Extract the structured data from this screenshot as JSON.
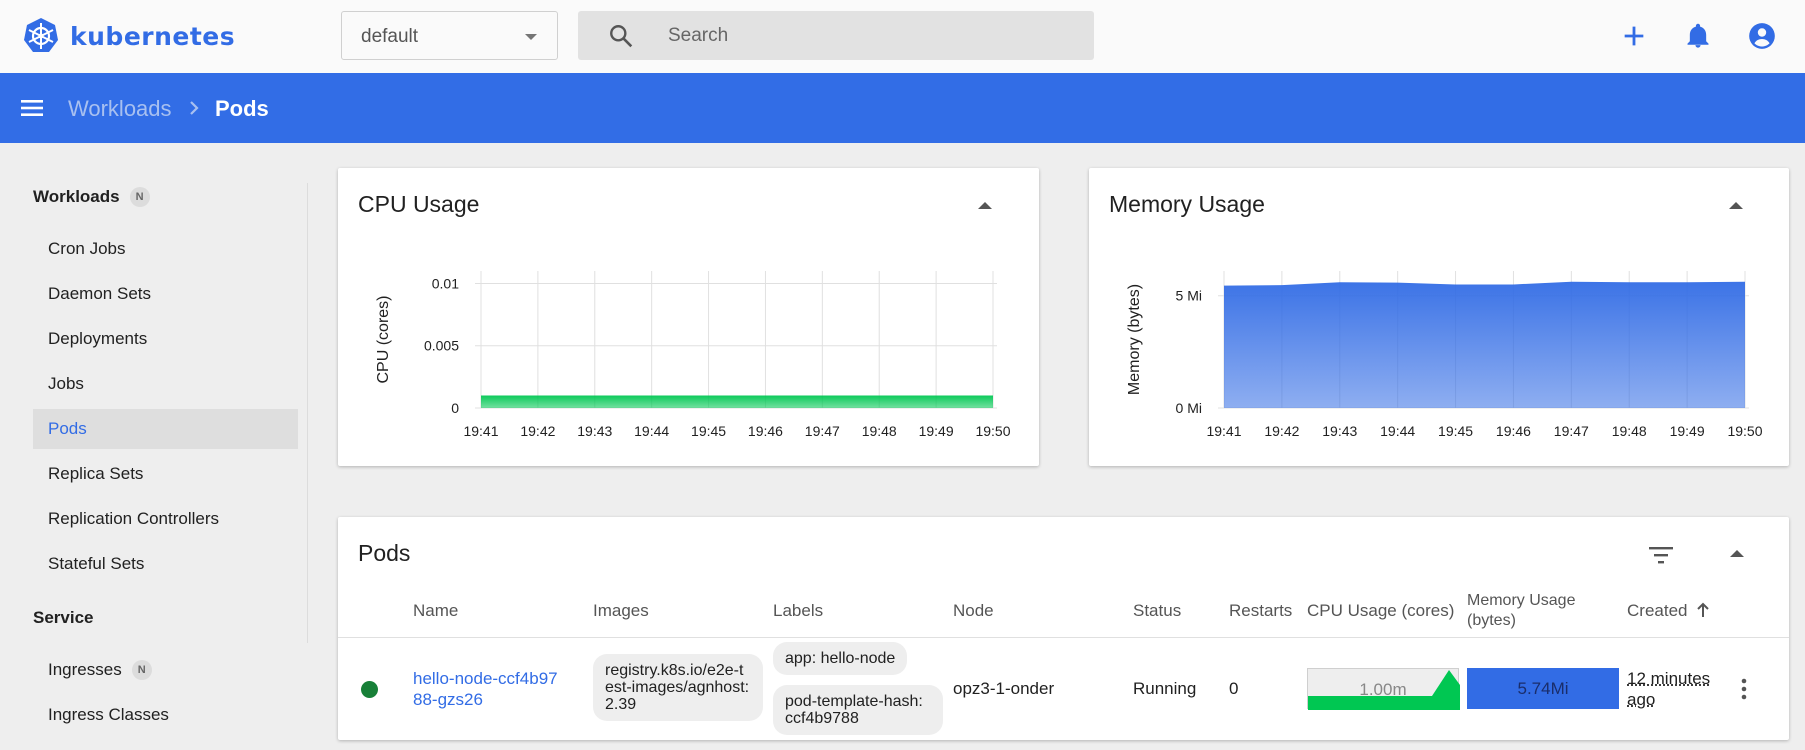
{
  "app": {
    "name": "kubernetes"
  },
  "namespace": {
    "selected": "default"
  },
  "search": {
    "placeholder": "Search"
  },
  "breadcrumb": {
    "parent": "Workloads",
    "current": "Pods"
  },
  "sidebar": {
    "workloads_header": "Workloads",
    "workloads_badge": "N",
    "workload_items": [
      "Cron Jobs",
      "Daemon Sets",
      "Deployments",
      "Jobs",
      "Pods",
      "Replica Sets",
      "Replication Controllers",
      "Stateful Sets"
    ],
    "active_item": "Pods",
    "service_header": "Service",
    "service_items": [
      "Ingresses",
      "Ingress Classes"
    ],
    "ingresses_badge": "N"
  },
  "cpu_card": {
    "title": "CPU Usage"
  },
  "memory_card": {
    "title": "Memory Usage"
  },
  "chart_data": [
    {
      "type": "area",
      "title": "CPU Usage",
      "xlabel": "",
      "ylabel": "CPU (cores)",
      "x": [
        "19:41",
        "19:42",
        "19:43",
        "19:44",
        "19:45",
        "19:46",
        "19:47",
        "19:48",
        "19:49",
        "19:50"
      ],
      "y_ticks": [
        "0.01",
        "0.005",
        "0"
      ],
      "ylim": [
        0,
        0.011
      ],
      "series": [
        {
          "values": [
            0.001,
            0.001,
            0.001,
            0.001,
            0.001,
            0.001,
            0.001,
            0.001,
            0.001,
            0.001
          ]
        }
      ],
      "color": "#00c752",
      "grid": true
    },
    {
      "type": "area",
      "title": "Memory Usage",
      "xlabel": "",
      "ylabel": "Memory (bytes)",
      "x": [
        "19:41",
        "19:42",
        "19:43",
        "19:44",
        "19:45",
        "19:46",
        "19:47",
        "19:48",
        "19:49",
        "19:50"
      ],
      "y_ticks": [
        "5 Mi",
        "0 Mi"
      ],
      "ylim": [
        0,
        6.1
      ],
      "series": [
        {
          "values": [
            5.45,
            5.47,
            5.6,
            5.58,
            5.5,
            5.5,
            5.62,
            5.6,
            5.6,
            5.62
          ]
        }
      ],
      "color": "#326ce5",
      "grid": true
    }
  ],
  "pods_card": {
    "title": "Pods",
    "columns": [
      "Name",
      "Images",
      "Labels",
      "Node",
      "Status",
      "Restarts",
      "CPU Usage (cores)",
      "Memory Usage (bytes)",
      "Created"
    ],
    "rows": [
      {
        "status_color": "#188038",
        "name": "hello-node-ccf4b9788-gzs26",
        "image": "registry.k8s.io/e2e-test-images/agnhost:2.39",
        "labels": [
          "app: hello-node",
          "pod-template-hash: ccf4b9788"
        ],
        "node": "opz3-1-onder",
        "status": "Running",
        "restarts": "0",
        "cpu": "1.00m",
        "memory": "5.74Mi",
        "created": "12 minutes ago"
      }
    ]
  }
}
